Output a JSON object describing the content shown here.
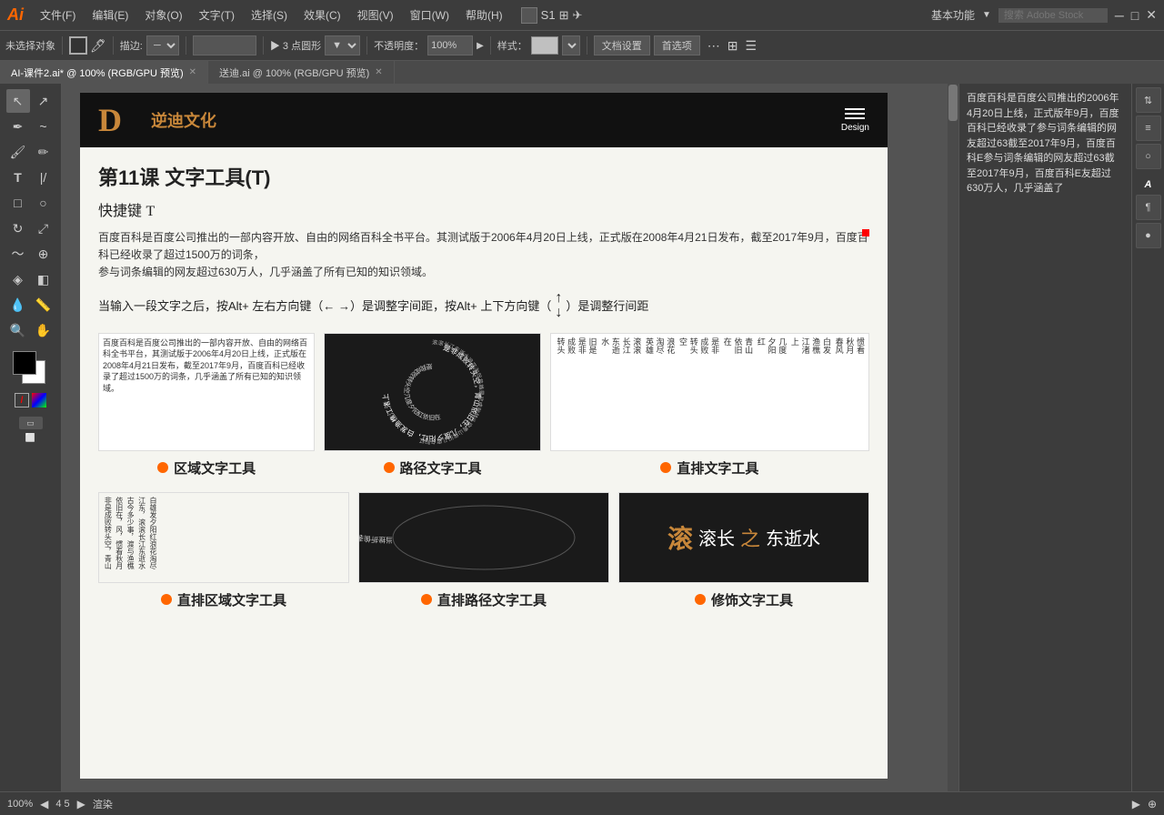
{
  "app": {
    "logo": "Ai",
    "title": "Adobe Illustrator"
  },
  "menu": {
    "items": [
      "文件(F)",
      "编辑(E)",
      "对象(O)",
      "文字(T)",
      "选择(S)",
      "效果(C)",
      "视图(V)",
      "窗口(W)",
      "帮助(H)"
    ],
    "right": {
      "label": "基本功能",
      "search_placeholder": "搜索 Adobe Stock"
    }
  },
  "toolbar": {
    "no_selection": "未选择对象",
    "scatter": "描边:",
    "points_label": "▶ 3 点圆形",
    "opacity_label": "不透明度：",
    "opacity_value": "100%",
    "style_label": "样式：",
    "doc_settings": "文档设置",
    "preferences": "首选项"
  },
  "tabs": [
    {
      "label": "AI-课件2.ai* @ 100% (RGB/GPU 预览)",
      "active": true
    },
    {
      "label": "送迪.ai @ 100% (RGB/GPU 预览)",
      "active": false
    }
  ],
  "artboard": {
    "header": {
      "logo_text": "逆迪文化",
      "nav_label": "Design"
    },
    "content": {
      "title": "第11课   文字工具(T)",
      "shortcut_label": "快捷键",
      "shortcut_key": "T",
      "body_text": "百度百科是百度公司推出的一部内容开放、自由的网络百科全书平台。其测试版于2006年4月20日上线，正式版在2008年4月21日发布，截至2017年9月，百度百科已经收录了超过1500万的词条，\n参与词条编辑的网友超过630万人，几乎涵盖了所有已知的知识领域。",
      "arrow_text": "当输入一段文字之后，按Alt+ 左右方向键（← →）是调整字间距，按Alt+ 上下方向键（  ）是调整行间距",
      "tools": [
        {
          "name": "区域文字工具",
          "preview_type": "area"
        },
        {
          "name": "路径文字工具",
          "preview_type": "path_circle"
        },
        {
          "name": "直排文字工具",
          "preview_type": "vertical"
        }
      ],
      "tools_bottom": [
        {
          "name": "直排区域文字工具",
          "preview_type": "vertical_area"
        },
        {
          "name": "直排路径文字工具",
          "preview_type": "path_vertical"
        },
        {
          "name": "修饰文字工具",
          "preview_type": "decoration"
        }
      ]
    }
  },
  "right_panel": {
    "text": "百度百科是百度公司推出的2006年4月20日上线，正式版年9月，百度百科已经收录了参与词条编辑的网友超过63截至2017年9月，百度百科E参与词条编辑的网友超过63截至2017年9月，百度百科E友超过630万人，几乎涵盖了"
  },
  "bottom_bar": {
    "zoom": "100%",
    "page_info": "4 5",
    "status": "渲染"
  }
}
